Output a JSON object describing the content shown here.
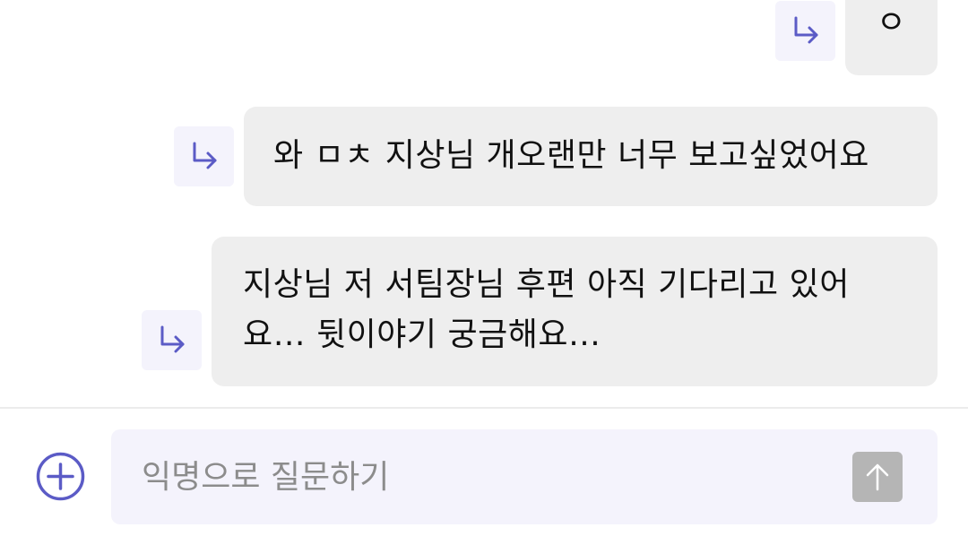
{
  "colors": {
    "accent": "#5b5bc6",
    "bubble_bg": "#eeeeee",
    "reply_button_bg": "#f4f3fc",
    "input_bg": "#f4f3fc",
    "send_button_bg": "#b5b5b5",
    "divider": "#ececec"
  },
  "messages": [
    {
      "text": "ㅇ",
      "reply_icon": "reply-arrow-icon"
    },
    {
      "text": "와 ㅁㅊ 지상님 개오랜만 너무 보고싶었어요",
      "reply_icon": "reply-arrow-icon"
    },
    {
      "text": "지상님 저 서팀장님 후편 아직 기다리고 있어요… 뒷이야기 궁금해요…",
      "reply_icon": "reply-arrow-icon"
    }
  ],
  "composer": {
    "add_icon": "plus-circle-icon",
    "placeholder": "익명으로 질문하기",
    "value": "",
    "send_icon": "arrow-up-icon"
  }
}
